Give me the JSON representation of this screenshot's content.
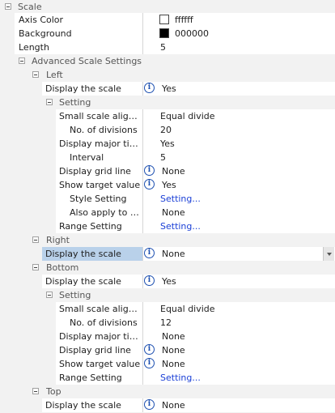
{
  "scale": {
    "title": "Scale",
    "axis_color": {
      "label": "Axis Color",
      "value": "ffffff",
      "swatch": "#ffffff"
    },
    "background": {
      "label": "Background",
      "value": "000000",
      "swatch": "#000000"
    },
    "length": {
      "label": "Length",
      "value": "5"
    },
    "advanced": {
      "title": "Advanced Scale Settings",
      "left": {
        "title": "Left",
        "display_scale": {
          "label": "Display the scale",
          "value": "Yes"
        },
        "setting": {
          "title": "Setting",
          "small_scale_alignment": {
            "label": "Small scale alignment",
            "value": "Equal divide"
          },
          "no_divisions": {
            "label": "No. of divisions",
            "value": "20"
          },
          "display_major": {
            "label": "Display major tick mar...",
            "value": "Yes"
          },
          "interval": {
            "label": "Interval",
            "value": "5"
          },
          "display_grid": {
            "label": "Display grid line",
            "value": "None"
          },
          "show_target": {
            "label": "Show target value",
            "value": "Yes"
          },
          "style_setting": {
            "label": "Style Setting",
            "value": "Setting..."
          },
          "also_apply": {
            "label": "Also apply to minor ...",
            "value": "None"
          },
          "range_setting": {
            "label": "Range Setting",
            "value": "Setting..."
          }
        }
      },
      "right": {
        "title": "Right",
        "display_scale": {
          "label": "Display the scale",
          "value": "None"
        }
      },
      "bottom": {
        "title": "Bottom",
        "display_scale": {
          "label": "Display the scale",
          "value": "Yes"
        },
        "setting": {
          "title": "Setting",
          "small_scale_alignment": {
            "label": "Small scale alignment",
            "value": "Equal divide"
          },
          "no_divisions": {
            "label": "No. of divisions",
            "value": "12"
          },
          "display_major": {
            "label": "Display major tick mar...",
            "value": "None"
          },
          "display_grid": {
            "label": "Display grid line",
            "value": "None"
          },
          "show_target": {
            "label": "Show target value",
            "value": "None"
          },
          "range_setting": {
            "label": "Range Setting",
            "value": "Setting..."
          }
        }
      },
      "top": {
        "title": "Top",
        "display_scale": {
          "label": "Display the scale",
          "value": "None"
        }
      }
    }
  },
  "icons": {
    "info": "info-icon",
    "expander": "collapse-icon",
    "dropdown": "chevron-down-icon"
  },
  "colors": {
    "link": "#1a3fd6",
    "selection": "#b9d1ea",
    "info": "#1c4fb0"
  }
}
